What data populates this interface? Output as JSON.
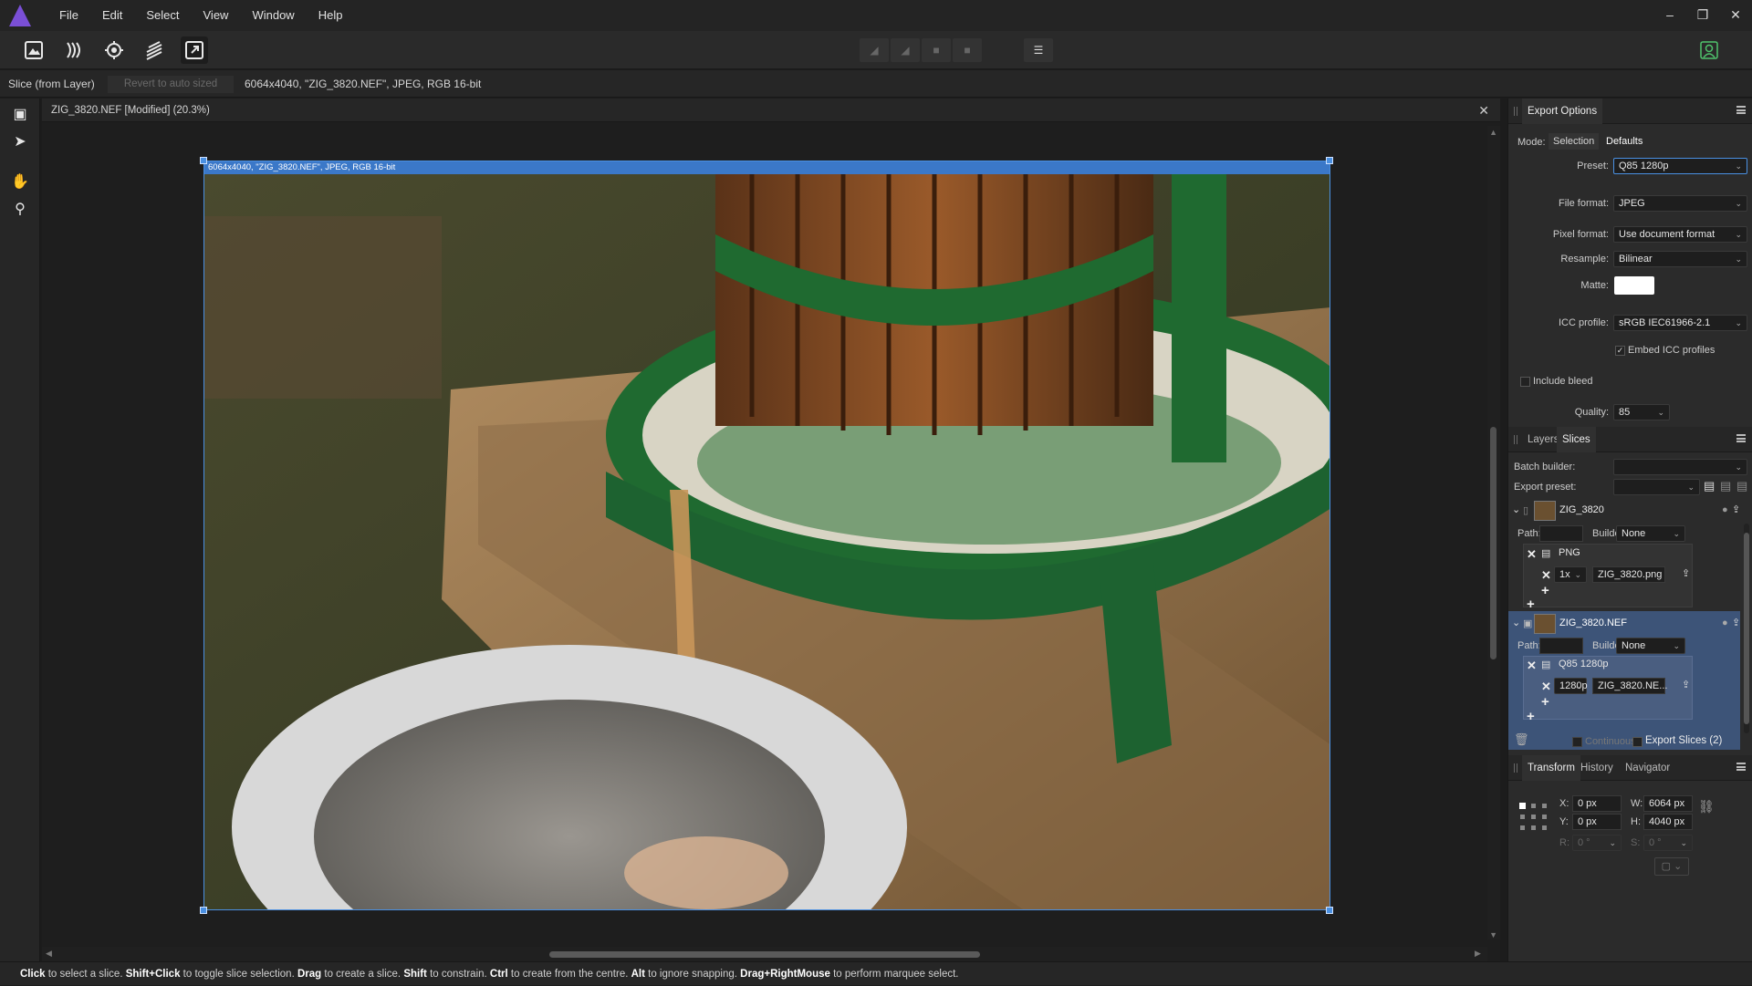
{
  "menubar": {
    "items": [
      "File",
      "Edit",
      "Select",
      "View",
      "Window",
      "Help"
    ],
    "minimize": "–",
    "restore": "❐",
    "close": "✕"
  },
  "context": {
    "tool_name": "Slice (from Layer)",
    "revert_label": "Revert to auto sized",
    "info": "6064x4040, \"ZIG_3820.NEF\", JPEG, RGB 16-bit"
  },
  "document": {
    "tab_title": "ZIG_3820.NEF [Modified] (20.3%)",
    "close": "✕",
    "slice_label": "6064x4040, \"ZIG_3820.NEF\", JPEG, RGB 16-bit"
  },
  "export_options": {
    "title": "Export Options",
    "mode_label": "Mode:",
    "mode_selection": "Selection",
    "mode_defaults": "Defaults",
    "preset_label": "Preset:",
    "preset_value": "Q85 1280p",
    "file_format_label": "File format:",
    "file_format_value": "JPEG",
    "pixel_format_label": "Pixel format:",
    "pixel_format_value": "Use document format",
    "resample_label": "Resample:",
    "resample_value": "Bilinear",
    "matte_label": "Matte:",
    "icc_label": "ICC profile:",
    "icc_value": "sRGB IEC61966-2.1",
    "embed_icc": "Embed ICC profiles",
    "include_bleed": "Include bleed",
    "quality_label": "Quality:",
    "quality_value": "85"
  },
  "slices": {
    "tab_layers": "Layers",
    "tab_slices": "Slices",
    "batch_label": "Batch builder:",
    "export_preset_label": "Export preset:",
    "items": [
      {
        "name": "ZIG_3820",
        "path_label": "Path:",
        "builder_label": "Builder:",
        "builder_value": "None",
        "format": "PNG",
        "scale": "1x",
        "filename": "ZIG_3820.png"
      },
      {
        "name": "ZIG_3820.NEF",
        "path_label": "Path:",
        "builder_label": "Builder:",
        "builder_value": "None",
        "format": "Q85 1280p",
        "scale": "1280p",
        "filename": "ZIG_3820.NE..."
      }
    ],
    "continuous": "Continuous",
    "export_button": "Export Slices (2)"
  },
  "transform": {
    "tab_transform": "Transform",
    "tab_history": "History",
    "tab_navigator": "Navigator",
    "x_label": "X:",
    "x_value": "0 px",
    "y_label": "Y:",
    "y_value": "0 px",
    "w_label": "W:",
    "w_value": "6064 px",
    "h_label": "H:",
    "h_value": "4040 px",
    "r_label": "R:",
    "r_value": "0 °",
    "s_label": "S:",
    "s_value": "0 °"
  },
  "status": {
    "parts": [
      {
        "b": "Click",
        "t": " to select a slice. "
      },
      {
        "b": "Shift+Click",
        "t": " to toggle slice selection. "
      },
      {
        "b": "Drag",
        "t": " to create a slice. "
      },
      {
        "b": "Shift",
        "t": " to constrain. "
      },
      {
        "b": "Ctrl",
        "t": " to create from the centre. "
      },
      {
        "b": "Alt",
        "t": " to ignore snapping. "
      },
      {
        "b": "Drag+RightMouse",
        "t": " to perform marquee select."
      }
    ]
  },
  "colors": {
    "accent": "#4a90e2",
    "selection_row": "#3d5478"
  },
  "icons": [
    "affinity-logo",
    "persona-photo-icon",
    "persona-liquify-icon",
    "persona-develop-icon",
    "persona-tonemap-icon",
    "persona-export-icon",
    "user-icon",
    "view-tool-icon",
    "move-tool-icon",
    "hand-tool-icon",
    "zoom-tool-icon"
  ]
}
